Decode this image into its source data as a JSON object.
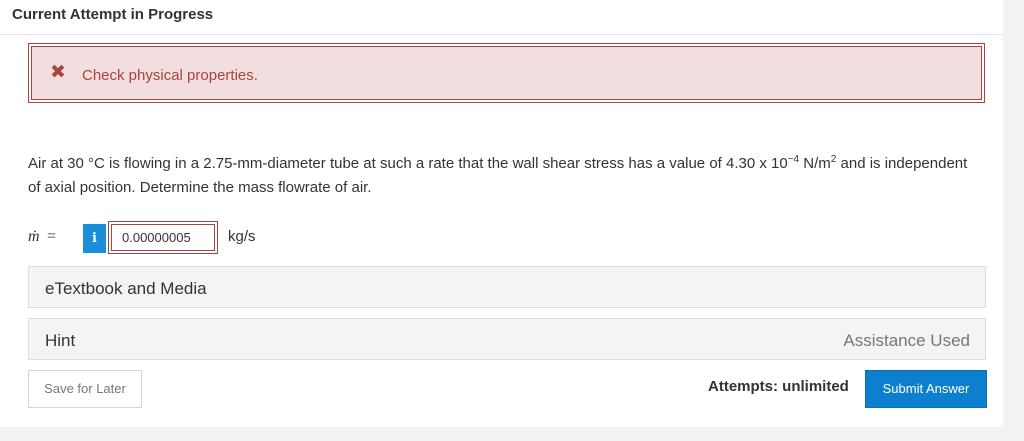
{
  "header": {
    "title": "Current Attempt in Progress"
  },
  "alert": {
    "icon": "close-x-icon",
    "icon_glyph": "✖",
    "message": "Check physical properties."
  },
  "question": {
    "text_part1": "Air at 30 °C is flowing in a 2.75-mm-diameter tube at such a rate that the wall shear stress has a value of 4.30 x 10",
    "exponent": "−4",
    "text_part2": " N/m",
    "exponent2": "2",
    "text_part3": " and is independent of axial position. Determine the mass flowrate of air."
  },
  "answer": {
    "variable": "ṁ",
    "equals": "=",
    "info_icon": "info-icon",
    "info_glyph": "i",
    "value": "0.00000005",
    "unit": "kg/s"
  },
  "sections": {
    "etextbook_label": "eTextbook and Media",
    "hint_label": "Hint",
    "hint_status": "Assistance Used"
  },
  "footer": {
    "save_label": "Save for Later",
    "attempts_text": "Attempts: unlimited",
    "submit_label": "Submit Answer"
  },
  "colors": {
    "error": "#a94442",
    "error_bg": "#f2dede",
    "primary": "#0d7fcf",
    "info": "#1a8ed8"
  }
}
